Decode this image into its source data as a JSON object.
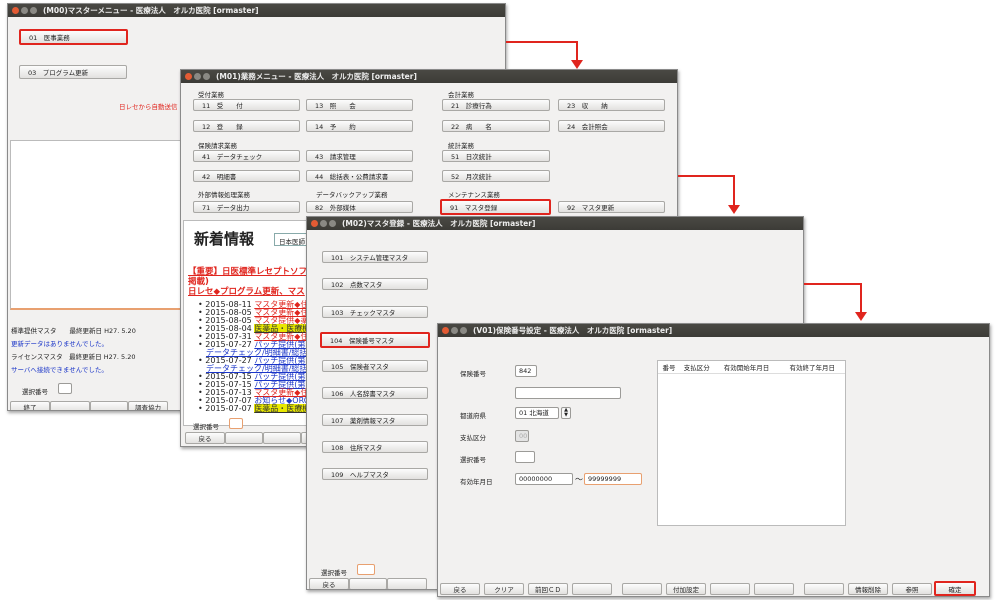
{
  "m00": {
    "title": "(M00)マスターメニュー - 医療法人　オルカ医院 [ormaster]",
    "btn01": "01　医事業務",
    "btn03": "03　プログラム更新",
    "notice": "日レセから自動送信",
    "std_master": "標準提供マスタ　　最終更新日 H27. 5.20",
    "no_update": "更新データはありませんでした。",
    "license_master": "ライセンスマスタ　最終更新日 H27. 5.20",
    "no_server": "サーバへ接続できませんでした。",
    "select_label": "選択番号",
    "fkeys": [
      "終了",
      "",
      "",
      "調査協力"
    ]
  },
  "m01": {
    "title": "(M01)業務メニュー - 医療法人　オルカ医院 [ormaster]",
    "sections": {
      "reception": "受付業務",
      "accounting": "会計業務",
      "insurance_claim": "保険請求業務",
      "statistics": "統計業務",
      "external": "外部情報処理業務",
      "backup": "データバックアップ業務",
      "maintenance": "メンテナンス業務"
    },
    "btns": {
      "b11": "11　受　　付",
      "b13": "13　照　　会",
      "b21": "21　診療行為",
      "b23": "23　収　　納",
      "b12": "12　登　　録",
      "b14": "14　予　　約",
      "b22": "22　病　　名",
      "b24": "24　会計照会",
      "b41": "41　データチェック",
      "b43": "43　請求管理",
      "b51": "51　日次統計",
      "b42": "42　明細書",
      "b44": "44　総括表・公費請求書",
      "b52": "52　月次統計",
      "b71": "71　データ出力",
      "b82": "82　外部媒体",
      "b91": "91　マスタ登録",
      "b92": "92　マスタ更新"
    },
    "news_title": "新着情報",
    "news_tab": "日本医師",
    "news_important": "【重要】日医標準レセプトソフ",
    "news_important2": "掲載)",
    "news_important3": "日レセ◆プログラム更新、マス",
    "news_items": [
      {
        "date": "2015-08-11",
        "text": "マスタ更新◆住"
      },
      {
        "date": "2015-08-05",
        "text": "マスタ更新◆住"
      },
      {
        "date": "2015-08-05",
        "text": "マスタ提供◆薬"
      },
      {
        "date": "2015-08-04",
        "text": "医薬品・医療機"
      },
      {
        "date": "2015-07-31",
        "text": "マスタ更新◆住"
      },
      {
        "date": "2015-07-27",
        "text": "パッチ提供(第"
      },
      {
        "date": "",
        "text": "データチェック/明細書/総括"
      },
      {
        "date": "2015-07-27",
        "text": "パッチ提供(第"
      },
      {
        "date": "",
        "text": "データチェック/明細書/総括"
      },
      {
        "date": "2015-07-15",
        "text": "パッチ提供(第"
      },
      {
        "date": "2015-07-15",
        "text": "パッチ提供(第"
      },
      {
        "date": "2015-07-13",
        "text": "マスタ更新◆住"
      },
      {
        "date": "2015-07-07",
        "text": "お知らせ◆ORC"
      },
      {
        "date": "2015-07-07",
        "text": "医薬品・医療機"
      }
    ],
    "select_label": "選択番号",
    "fkey_back": "戻る"
  },
  "m02": {
    "title": "(M02)マスタ登録 - 医療法人　オルカ医院 [ormaster]",
    "items": [
      "101　システム管理マスタ",
      "102　点数マスタ",
      "103　チェックマスタ",
      "104　保険番号マスタ",
      "105　保険者マスタ",
      "106　人名辞書マスタ",
      "107　薬剤情報マスタ",
      "108　住所マスタ",
      "109　ヘルプマスタ"
    ],
    "select_label": "選択番号",
    "fkey_back": "戻る"
  },
  "v01": {
    "title": "(V01)保険番号設定 - 医療法人　オルカ医院 [ormaster]",
    "label_insno": "保険番号",
    "insno_value": "842",
    "label_pref": "都道府県",
    "pref_value": "01 北海道",
    "label_payclass": "支払区分",
    "payclass_value": "00",
    "label_select": "選択番号",
    "label_valid": "有効年月日",
    "valid_from": "00000000",
    "tilde": "～",
    "valid_to": "99999999",
    "table_headers": [
      "番号",
      "支払区分",
      "有効開始年月日",
      "有効終了年月日"
    ],
    "fkeys": [
      "戻る",
      "クリア",
      "前回ＣＤ",
      "",
      "",
      "付加設定",
      "",
      "",
      "",
      "情報削除",
      "参照",
      "確定"
    ]
  }
}
